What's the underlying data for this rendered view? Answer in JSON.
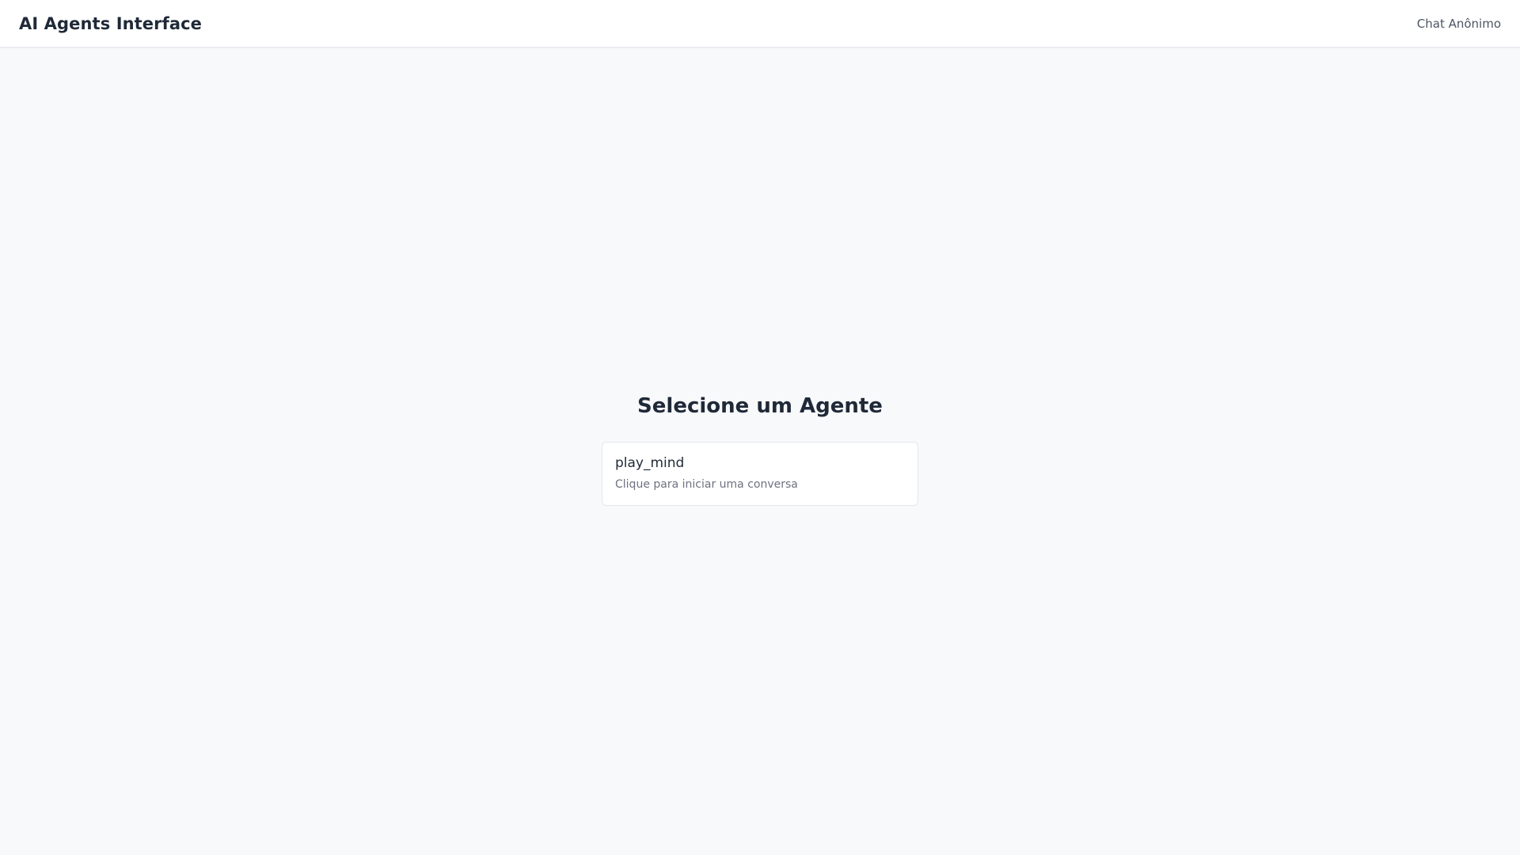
{
  "header": {
    "title": "AI Agents Interface",
    "anonymous_chat_label": "Chat Anônimo"
  },
  "main": {
    "heading": "Selecione um Agente",
    "agents": [
      {
        "name": "play_mind",
        "description": "Clique para iniciar uma conversa"
      }
    ]
  }
}
